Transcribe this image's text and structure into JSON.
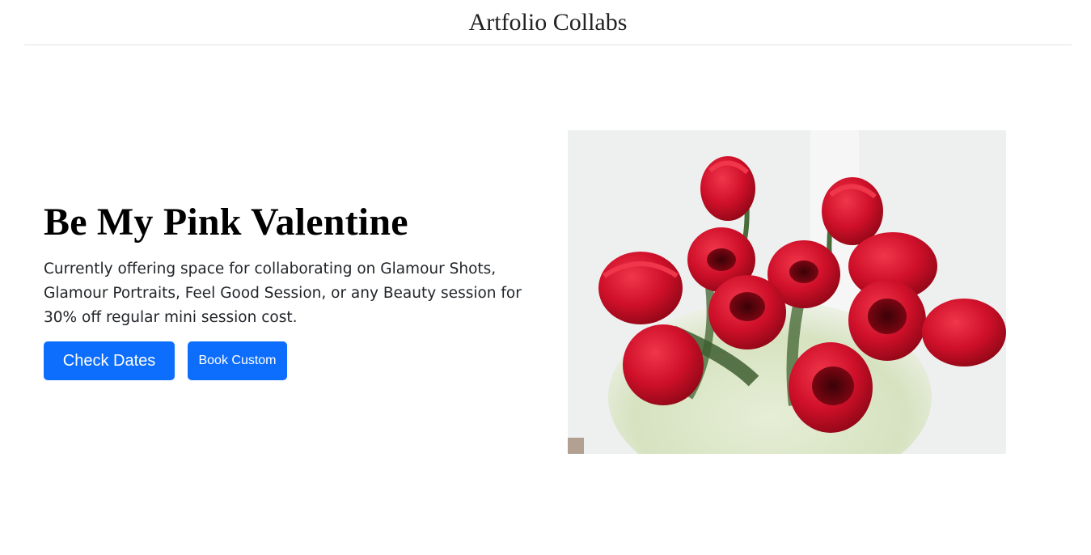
{
  "header": {
    "site_title": "Artfolio Collabs"
  },
  "hero": {
    "title": "Be My Pink Valentine",
    "description": "Currently offering space for collaborating on Glamour Shots, Glamour Portraits, Feel Good Session, or any Beauty session for 30% off regular mini session cost.",
    "primary_button": "Check Dates",
    "secondary_button": "Book Custom",
    "image_alt": "Bouquet of red tulips"
  },
  "colors": {
    "accent": "#0d6efd",
    "tulip": "#d0102a",
    "leaf": "#4a6b3a"
  }
}
